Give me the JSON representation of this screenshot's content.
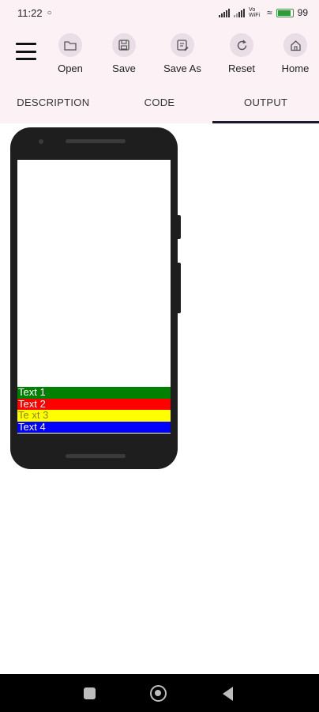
{
  "status_bar": {
    "time": "11:22",
    "network": "Vo WiFi",
    "battery": "99"
  },
  "toolbar": {
    "tools": [
      {
        "label": "Open",
        "icon": "folder-icon"
      },
      {
        "label": "Save",
        "icon": "save-icon"
      },
      {
        "label": "Save As",
        "icon": "save-as-icon"
      },
      {
        "label": "Reset",
        "icon": "reset-icon"
      },
      {
        "label": "Home",
        "icon": "home-icon"
      }
    ]
  },
  "tabs": [
    {
      "label": "DESCRIPTION",
      "active": false
    },
    {
      "label": "CODE",
      "active": false
    },
    {
      "label": "OUTPUT",
      "active": true
    }
  ],
  "output": {
    "rows": [
      {
        "text": "Text 1",
        "bg": "#008000",
        "color": "#ffffff"
      },
      {
        "text": "Text 2",
        "bg": "#ff0000",
        "color": "#ffffff"
      },
      {
        "text": "Te xt 3",
        "bg": "#ffff00",
        "color": "#8a8a00"
      },
      {
        "text": "Text 4",
        "bg": "#0000ff",
        "color": "#ffffff"
      }
    ]
  }
}
